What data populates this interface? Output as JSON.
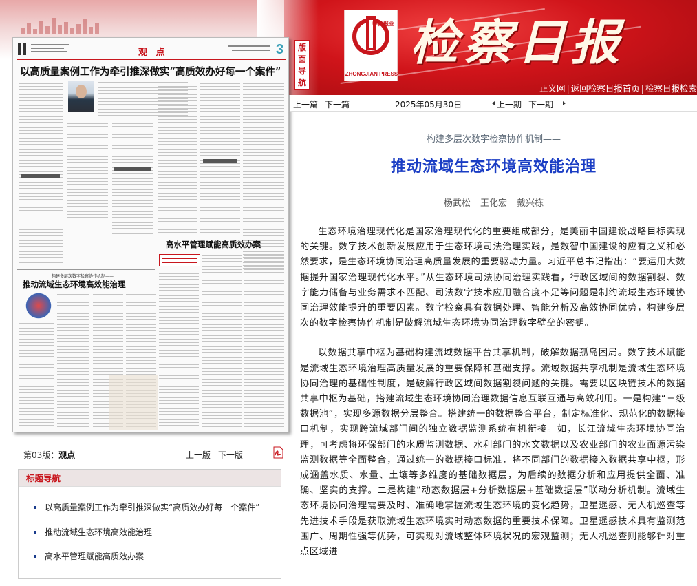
{
  "banner": {
    "logo_cn": "中检报业",
    "logo_en": "ZHONGJIAN PRESS",
    "masthead": "检察日报",
    "links": [
      "正义网",
      "返回检察日报首页",
      "检察日报检索"
    ]
  },
  "page_guide_tab": "版面导航",
  "newspaper": {
    "section": "观 点",
    "page_number": "3",
    "headline_1": "以高质量案例工作为牵引推深做实“高质效办好每一个案件”",
    "kicker_2": "构建多层次数字检察协作机制——",
    "headline_2": "推动流域生态环境高效能治理",
    "headline_3": "高水平管理赋能高质效办案"
  },
  "page_nav": {
    "page_label": "第03版：",
    "page_name": "观点",
    "prev_page": "上一版",
    "next_page": "下一版",
    "pdf_icon": "pdf-icon"
  },
  "toc": {
    "title": "标题导航",
    "items": [
      "以高质量案例工作为牵引推深做实“高质效办好每一个案件”",
      "推动流域生态环境高效能治理",
      "高水平管理赋能高质效办案"
    ]
  },
  "nav_bar": {
    "prev_article": "上一篇",
    "next_article": "下一篇",
    "date": "2025年05月30日",
    "prev_day": "上一期",
    "next_day": "下一期"
  },
  "article": {
    "kicker": "构建多层次数字检察协作机制——",
    "title": "推动流域生态环境高效能治理",
    "authors": "杨武松 王化宏 戴兴栋",
    "paragraphs": [
      "生态环境治理现代化是国家治理现代化的重要组成部分，是美丽中国建设战略目标实现的关键。数字技术创新发展应用于生态环境司法治理实践，是数智中国建设的应有之义和必然要求，是生态环境协同治理高质量发展的重要驱动力量。习近平总书记指出：“要运用大数据提升国家治理现代化水平。”从生态环境司法协同治理实践看，行政区域间的数据割裂、数字能力储备与业务需求不匹配、司法数字技术应用融合度不足等问题是制约流域生态环境协同治理效能提升的重要因素。数字检察具有数据处理、智能分析及高效协同优势，构建多层次的数字检察协作机制是破解流域生态环境协同治理数字壁垒的密钥。",
      "以数据共享中枢为基础构建流域数据平台共享机制，破解数据孤岛困局。数字技术赋能是流域生态环境治理高质量发展的重要保障和基础支撑。流域数据共享机制是流域生态环境协同治理的基础性制度，是破解行政区域间数据割裂问题的关键。需要以区块链技术的数据共享中枢为基础，搭建流域生态环境协同治理数据信息互联互通与高效利用。一是构建“三级数据池”，实现多源数据分层整合。搭建统一的数据整合平台，制定标准化、规范化的数据接口机制，实现跨流域部门间的独立数据监测系统有机衔接。如，长江流域生态环境协同治理，可考虑将环保部门的水质监测数据、水利部门的水文数据以及农业部门的农业面源污染监测数据等全面整合，通过统一的数据接口标准，将不同部门的数据接入数据共享中枢，形成涵盖水质、水量、土壤等多维度的基础数据层，为后续的数据分析和应用提供全面、准确、坚实的支撑。二是构建“动态数据层+分析数据层+基础数据层”联动分析机制。流域生态环境协同治理需要及时、准确地掌握流域生态环境的变化趋势，卫星遥感、无人机巡查等先进技术手段是获取流域生态环境实时动态数据的重要技术保障。卫星遥感技术具有监测范围广、周期性强等优势，可实现对流域整体环境状况的宏观监测；无人机巡查则能够针对重点区域进"
    ]
  }
}
